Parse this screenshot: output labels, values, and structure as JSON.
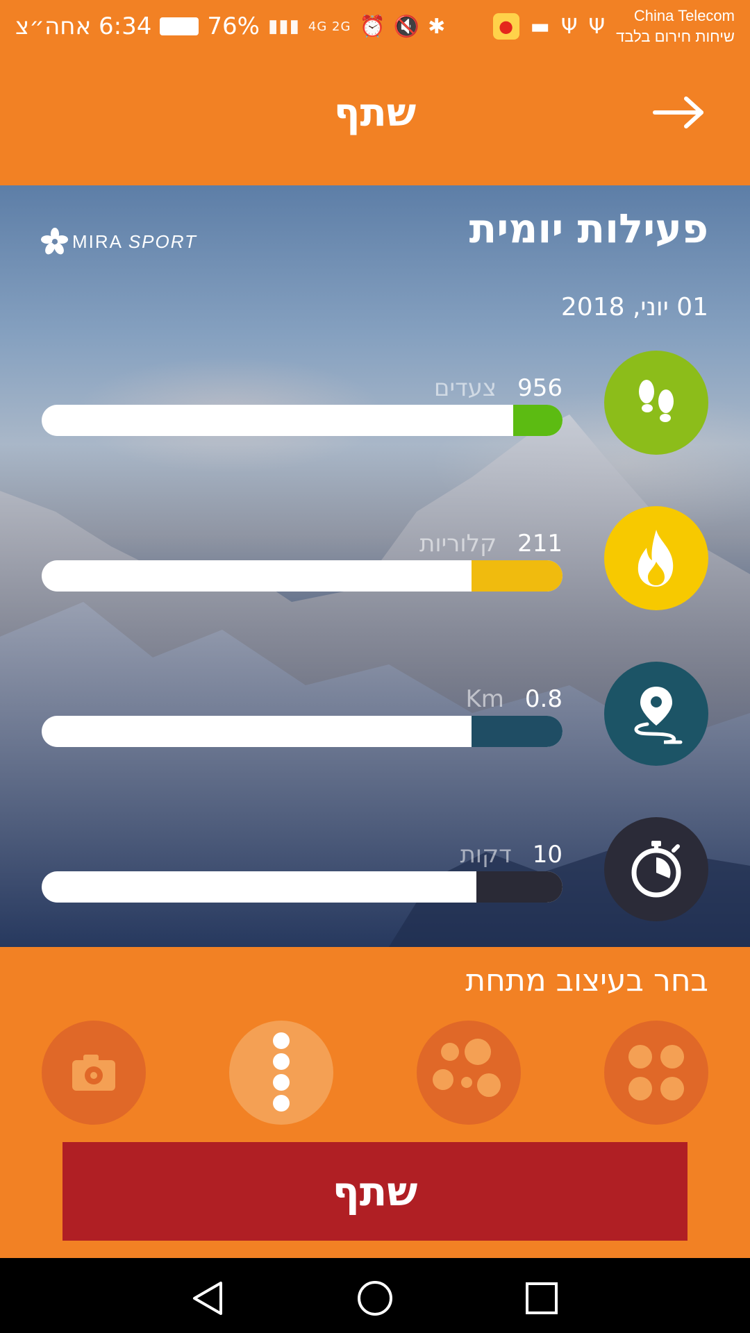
{
  "status_bar": {
    "time": "6:34 אחה״צ",
    "battery": "76%",
    "network": "4G 2G",
    "carrier": "China Telecom",
    "carrier_sub": "שיחות חירום בלבד",
    "icons": [
      "battery-icon",
      "signal-icon",
      "alarm-icon",
      "mute-icon",
      "bluetooth-icon",
      "weibo-icon",
      "briefcase-icon",
      "usb-icon"
    ]
  },
  "header": {
    "title": "שתף",
    "back_icon": "arrow-right-icon"
  },
  "card": {
    "title": "פעילות יומית",
    "brand": "MIRA",
    "brand_sport": "SPORT",
    "date": "01 יוני, 2018",
    "metrics": [
      {
        "name": "steps",
        "value": "956",
        "unit": "צעדים",
        "icon": "footsteps-icon",
        "color": "#8cbd1a",
        "bar_color": "#5cbb12",
        "fill": 0.095
      },
      {
        "name": "calories",
        "value": "211",
        "unit": "קלוריות",
        "icon": "flame-icon",
        "color": "#f7c900",
        "bar_color": "#f0bb0e",
        "fill": 0.175
      },
      {
        "name": "distance",
        "value": "0.8",
        "unit": "Km",
        "icon": "location-route-icon",
        "color": "#1c5466",
        "bar_color": "#1f4d64",
        "fill": 0.175
      },
      {
        "name": "duration",
        "value": "10",
        "unit": "דקות",
        "icon": "stopwatch-icon",
        "color": "#2b2b38",
        "bar_color": "#2a2a36",
        "fill": 0.166
      }
    ]
  },
  "style_picker": {
    "title": "בחר בעיצוב מתחת",
    "options": [
      {
        "name": "four-dots",
        "icon": "four-dots-icon",
        "selected": false
      },
      {
        "name": "scattered-dots",
        "icon": "scattered-dots-icon",
        "selected": false
      },
      {
        "name": "vertical-dots",
        "icon": "vertical-dots-icon",
        "selected": true
      },
      {
        "name": "camera",
        "icon": "camera-icon",
        "selected": false
      }
    ]
  },
  "share_button": {
    "label": "שתף",
    "color": "#b01f24"
  },
  "accent_color": "#f28124",
  "nav": {
    "icons": [
      "back-triangle-icon",
      "home-circle-icon",
      "recents-square-icon"
    ]
  }
}
